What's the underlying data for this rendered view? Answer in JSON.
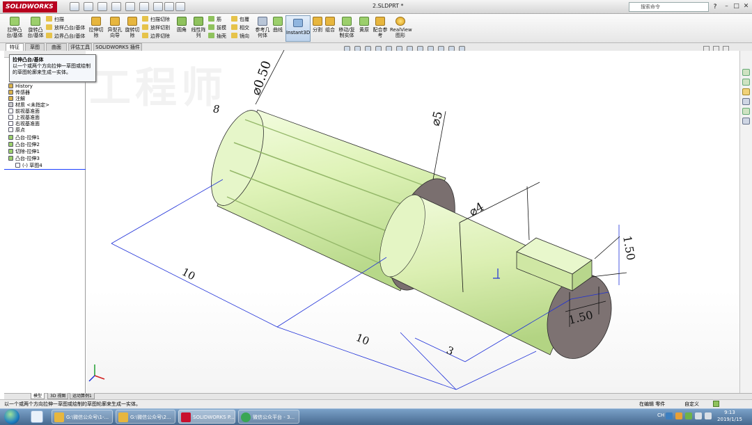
{
  "titlebar": {
    "logo": "SOLIDWORKS",
    "document": "2.SLDPRT *",
    "search_placeholder": "搜索命令",
    "help": "?",
    "min": "–",
    "restore": "□",
    "close": "✕"
  },
  "ribbon": {
    "extrude_boss": "拉伸凸台/基体",
    "revolve_boss": "旋转凸台/基体",
    "sweep": "扫描",
    "loft": "放样凸台/基体",
    "boundary_boss": "边界凸台/基体",
    "extrude_cut": "拉伸切除",
    "hole_wizard": "异型孔向导",
    "revolve_cut": "旋转切除",
    "sweep_cut": "扫描切除",
    "loft_cut": "放样切割",
    "boundary_cut": "边界切除",
    "fillet": "圆角",
    "linear_pattern": "线性阵列",
    "rib": "筋",
    "draft": "拔模",
    "shell": "抽壳",
    "wrap": "包覆",
    "intersect": "相交",
    "mirror": "镜向",
    "ref_geometry": "参考几何体",
    "curves": "曲线",
    "instant3d": "Instant3D",
    "split": "分割",
    "combine": "组合",
    "move_copy": "移动/复制实体",
    "drape": "黄原",
    "ref": "配合参考",
    "realview": "RealView图形"
  },
  "tabs": [
    "特征",
    "草图",
    "曲面",
    "评估工具",
    "SOLIDWORKS 插件"
  ],
  "tooltip": {
    "title": "拉伸凸台/基体",
    "desc": "以一个或两个方向拉伸一草图或绘制的草图轮廓来生成一实体。"
  },
  "tree": [
    {
      "label": "History",
      "color": "#d8b24a"
    },
    {
      "label": "传感器",
      "color": "#d8b24a"
    },
    {
      "label": "注解",
      "color": "#d8b24a"
    },
    {
      "label": "材质 <未指定>",
      "color": "#c9c9c9"
    },
    {
      "label": "前视基准面",
      "color": "#ffffff"
    },
    {
      "label": "上视基准面",
      "color": "#ffffff"
    },
    {
      "label": "右视基准面",
      "color": "#ffffff"
    },
    {
      "label": "原点",
      "color": "#ffffff"
    },
    {
      "label": "凸台-拉伸1",
      "color": "#9ccf6c"
    },
    {
      "label": "凸台-拉伸2",
      "color": "#9ccf6c"
    },
    {
      "label": "切除-拉伸1",
      "color": "#9ccf6c"
    },
    {
      "label": "凸台-拉伸3",
      "color": "#9ccf6c"
    },
    {
      "label": "(-) 草图4",
      "color": "#ffffff"
    }
  ],
  "model": {
    "body_color": "#dff3b8",
    "dim_color": "#1d2fd8",
    "dims": {
      "d050": "⌀0.50",
      "d8": "8",
      "d5": "⌀5",
      "d4": "⌀4",
      "l10a": "10",
      "l10b": "10",
      "l3": "3",
      "k150a": "1.50",
      "k150b": "1.50"
    }
  },
  "bottom_tabs": [
    "模型",
    "3D 视图",
    "运动算例1"
  ],
  "status": {
    "left": "以一个或两个方向拉伸一草图或绘制的草图轮廓来生成一实体。",
    "mode": "在编辑 零件",
    "unit": "自定义"
  },
  "taskbar": {
    "items": [
      {
        "label": "G:\\微信公众号\\1-...",
        "color": "#e7b63e"
      },
      {
        "label": "G:\\微信公众号\\2...",
        "color": "#e7b63e"
      },
      {
        "label": "SOLIDWORKS P...",
        "color": "#c8102e"
      },
      {
        "label": "微信公众平台 - 3...",
        "color": "#3aa655"
      }
    ],
    "lang": "CH",
    "time": "9:13",
    "date": "2019/1/15"
  }
}
